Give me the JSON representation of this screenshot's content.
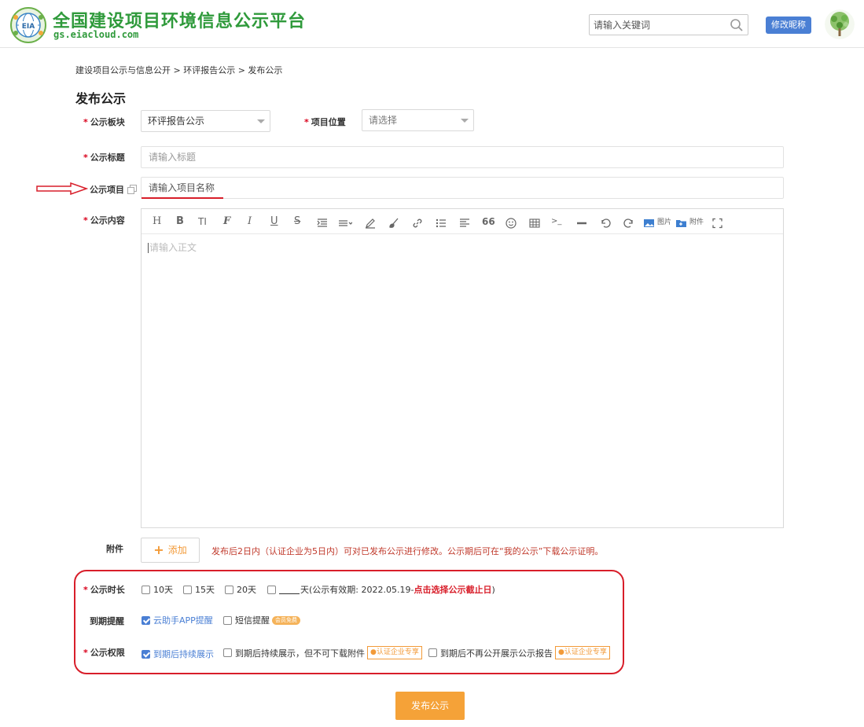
{
  "header": {
    "logo_text": "EIA",
    "site_title": "全国建设项目环境信息公示平台",
    "site_domain": "gs.eiacloud.com",
    "search_placeholder": "请输入关键词",
    "rename_button": "修改昵称"
  },
  "breadcrumb": "建设项目公示与信息公开 > 环评报告公示 > 发布公示",
  "page_title": "发布公示",
  "form": {
    "board_label": "公示板块",
    "board_value": "环评报告公示",
    "location_label": "项目位置",
    "location_value": "请选择",
    "title_label": "公示标题",
    "title_placeholder": "请输入标题",
    "project_label": "公示项目",
    "project_placeholder": "请输入项目名称",
    "content_label": "公示内容",
    "content_placeholder": "请输入正文",
    "toolbar": {
      "heading": "H",
      "bold": "B",
      "font_size": "TI",
      "font": "F",
      "italic": "I",
      "underline": "U",
      "strike": "S",
      "quote": "66",
      "code": ">_",
      "image_label": "图片",
      "attach_label": "附件"
    },
    "attachment_label": "附件",
    "add_button": "添加",
    "attachment_note": "发布后2日内（认证企业为5日内）可对已发布公示进行修改。公示期后可在“我的公示”下载公示证明。",
    "duration_label": "公示时长",
    "duration_options": [
      "10天",
      "15天",
      "20天"
    ],
    "custom_days_suffix": "天(公示有效期: 2022.05.19-",
    "custom_days_link": "点击选择公示截止日",
    "custom_days_close": ")",
    "reminder_label": "到期提醒",
    "reminder_app": "云助手APP提醒",
    "reminder_sms": "短信提醒",
    "reminder_sms_badge": "会员免费",
    "permission_label": "公示权限",
    "permission_opt1": "到期后持续展示",
    "permission_opt2": "到期后持续展示，但不可下载附件",
    "permission_opt3": "到期后不再公开展示公示报告",
    "certified_badge": "认证企业专享",
    "submit_button": "发布公示"
  },
  "colors": {
    "brand_green": "#2f9a3b",
    "blue_accent": "#4a7fd4",
    "orange_accent": "#f5a238",
    "annotation_red": "#d81e2a"
  }
}
